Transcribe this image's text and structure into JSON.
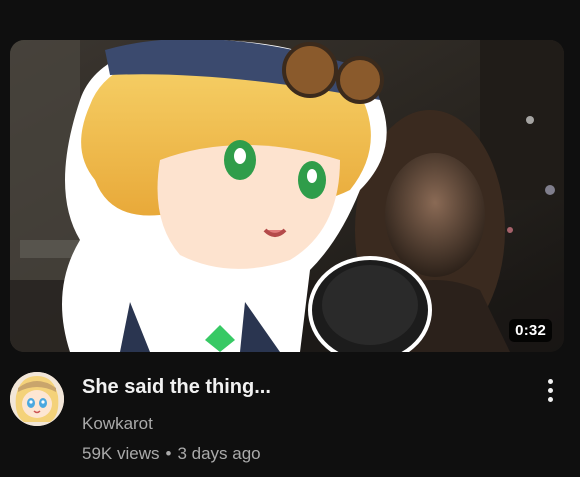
{
  "video": {
    "duration": "0:32",
    "title": "She said the thing...",
    "channel": "Kowkarot",
    "views": "59K views",
    "separator": "•",
    "age": "3 days ago"
  },
  "icons": {
    "more": "more-vertical-icon"
  },
  "colors": {
    "background": "#0f0f0f",
    "title": "#f1f1f1",
    "secondary": "#aaaaaa"
  }
}
